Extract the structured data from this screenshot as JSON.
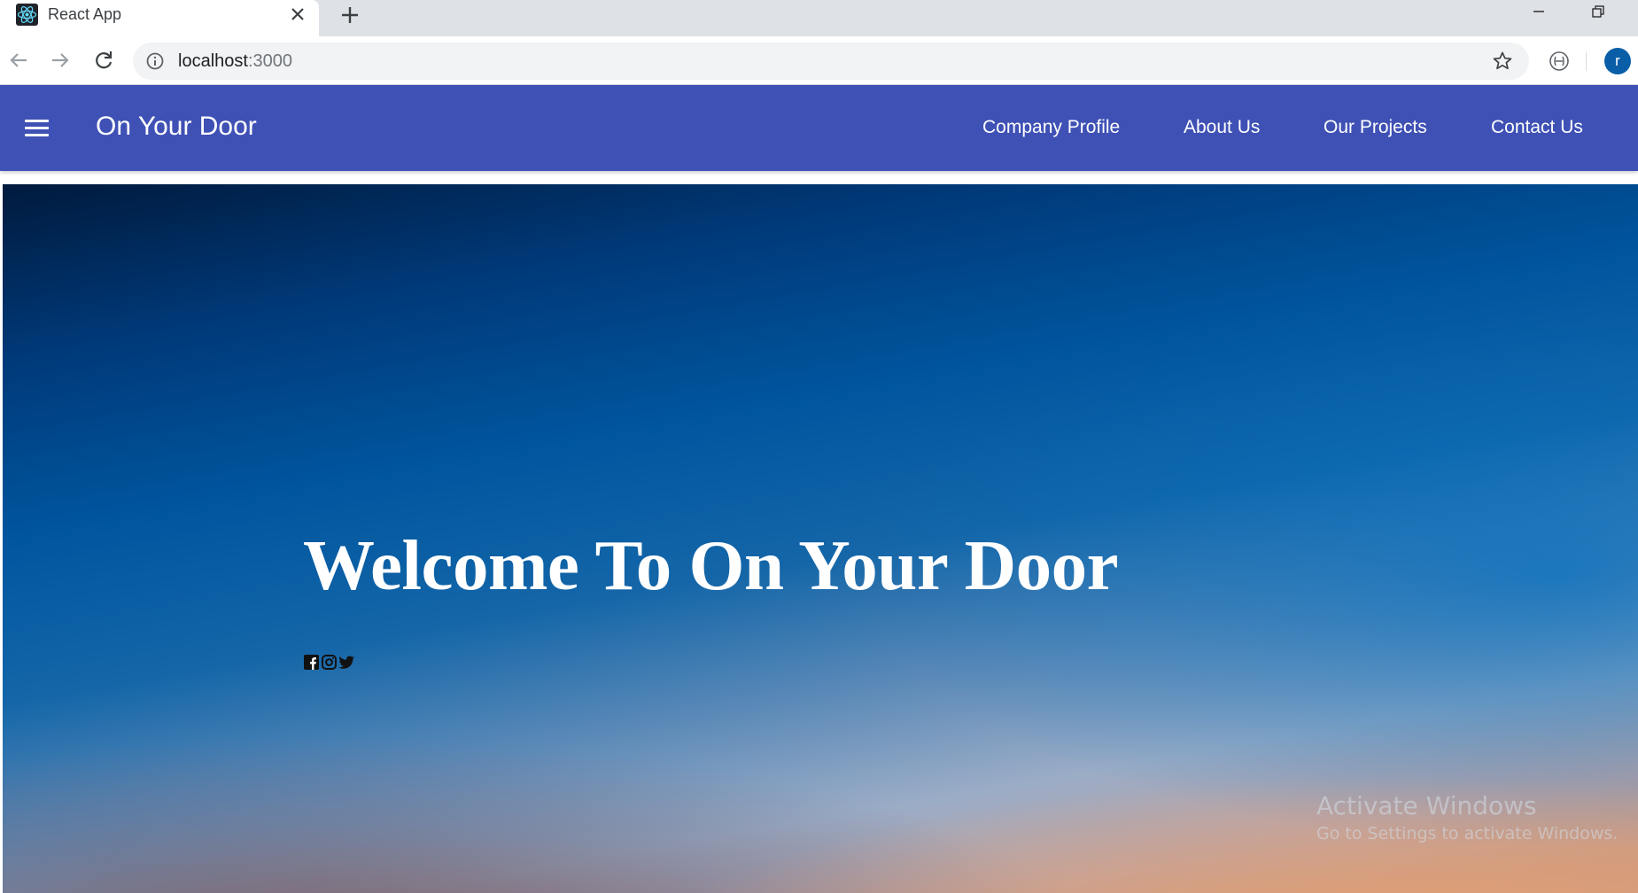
{
  "browser": {
    "tab": {
      "title": "React App",
      "favicon": "react-logo-icon",
      "close_icon": "close-icon"
    },
    "new_tab_icon": "plus-icon",
    "window_controls": [
      "minimize-icon",
      "restore-icon"
    ],
    "address": {
      "host": "localhost",
      "port": ":3000",
      "info_icon": "info-icon",
      "bookmark_icon": "star-icon"
    },
    "nav_icons": [
      "back-arrow-icon",
      "forward-arrow-icon",
      "reload-icon"
    ],
    "extension_icon": "extension-icon",
    "profile_initial": "r"
  },
  "appbar": {
    "brand": "On Your Door",
    "menu_icon": "hamburger-menu-icon",
    "background": "#3f51b5",
    "nav": [
      "Company Profile",
      "About Us",
      "Our Projects",
      "Contact Us"
    ]
  },
  "hero": {
    "title": "Welcome To On Your Door",
    "social_icons": [
      "facebook-icon",
      "instagram-icon",
      "twitter-icon"
    ]
  },
  "watermark": {
    "title": "Activate Windows",
    "subtitle": "Go to Settings to activate Windows."
  }
}
